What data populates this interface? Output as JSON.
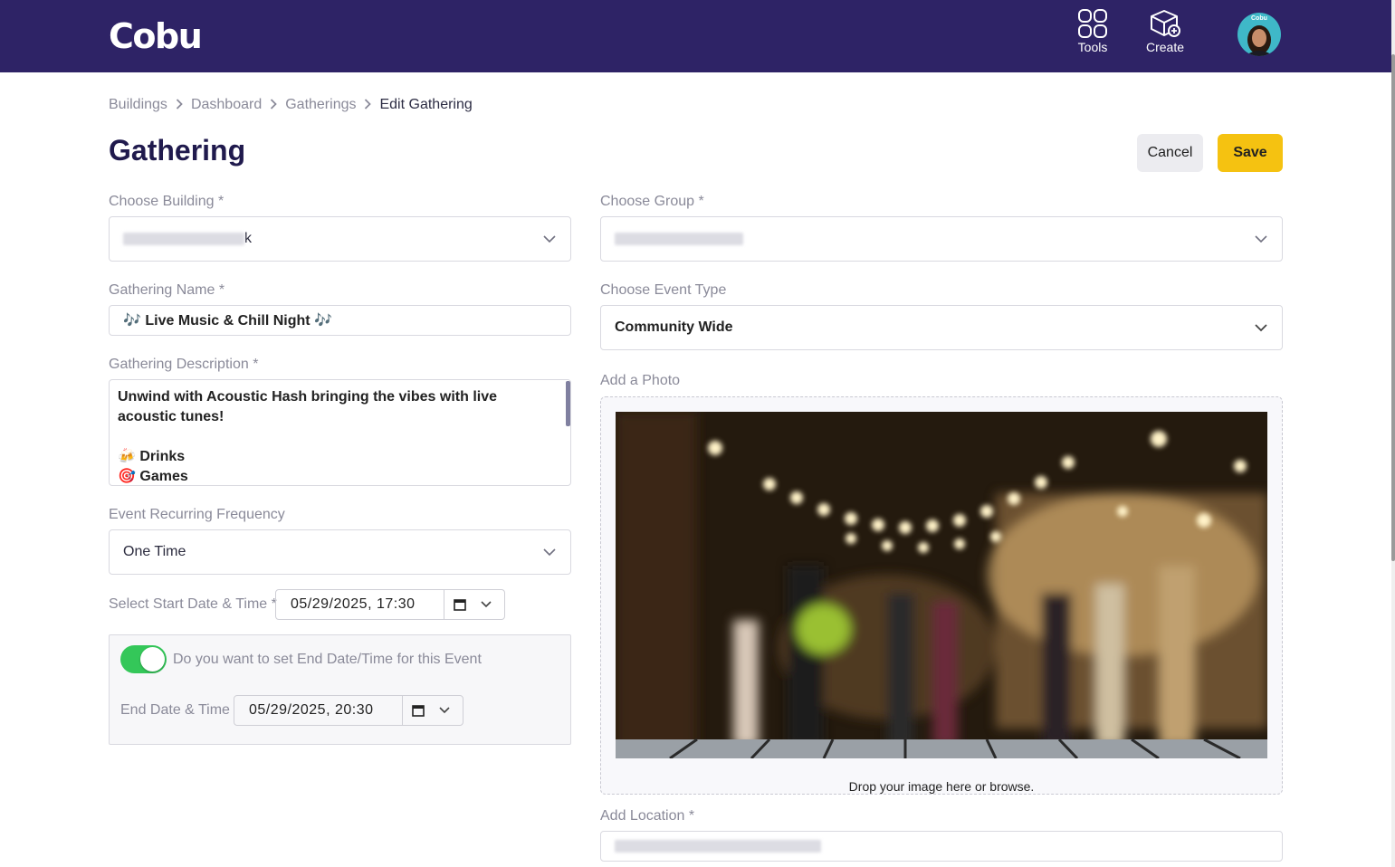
{
  "header": {
    "logo": "Cobu",
    "tools_label": "Tools",
    "create_label": "Create",
    "avatar_brand": "Cobu"
  },
  "breadcrumb": [
    "Buildings",
    "Dashboard",
    "Gatherings",
    "Edit Gathering"
  ],
  "page_title": "Gathering",
  "actions": {
    "cancel": "Cancel",
    "save": "Save"
  },
  "form": {
    "building": {
      "label": "Choose Building *",
      "value_tail": "k"
    },
    "group": {
      "label": "Choose Group *"
    },
    "name": {
      "label": "Gathering Name *",
      "value": "🎶 Live Music & Chill Night 🎶"
    },
    "event_type": {
      "label": "Choose Event Type",
      "value": "Community Wide"
    },
    "description": {
      "label": "Gathering Description *",
      "line1": "Unwind with Acoustic Hash bringing the vibes with live acoustic tunes!",
      "line2": "🍻 Drinks",
      "line3": "🎯 Games"
    },
    "frequency": {
      "label": "Event Recurring Frequency",
      "value": "One Time"
    },
    "start": {
      "label": "Select Start Date & Time *",
      "value": "05/29/2025, 17:30"
    },
    "end_toggle": {
      "label": "Do you want to set End Date/Time for this Event",
      "on": true
    },
    "end": {
      "label": "End Date & Time",
      "value": "05/29/2025, 20:30"
    },
    "photo": {
      "label": "Add a Photo",
      "drop_text": "Drop your image here or browse."
    },
    "location": {
      "label": "Add Location *"
    }
  }
}
